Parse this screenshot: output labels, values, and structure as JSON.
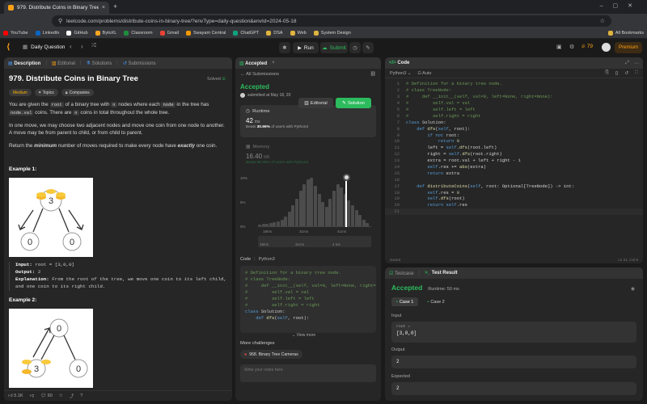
{
  "browser": {
    "tab_title": "979. Distribute Coins in Binary Tree",
    "url": "leetcode.com/problems/distribute-coins-in-binary-tree/?envType=daily-question&envId=2024-05-18",
    "bookmarks": [
      {
        "label": "YouTube",
        "color": "#ff0000"
      },
      {
        "label": "LinkedIn",
        "color": "#0a66c2"
      },
      {
        "label": "GitHub",
        "color": "#ffffff"
      },
      {
        "label": "BytoXL",
        "color": "#f5a623"
      },
      {
        "label": "Classroom",
        "color": "#1e8e3e"
      },
      {
        "label": "Gmail",
        "color": "#ea4335"
      },
      {
        "label": "Swayam Central",
        "color": "#f29900"
      },
      {
        "label": "ChatGPT",
        "color": "#10a37f"
      },
      {
        "label": "DSA",
        "color": "#e0b341"
      },
      {
        "label": "Web",
        "color": "#e0b341"
      },
      {
        "label": "System Design",
        "color": "#e0b341"
      }
    ],
    "all_bookmarks": "All Bookmarks"
  },
  "header": {
    "daily_question": "Daily Question",
    "run": "Run",
    "submit": "Submit",
    "fire_count": "79",
    "premium": "Premium"
  },
  "left": {
    "tabs": [
      "Description",
      "Editorial",
      "Solutions",
      "Submissions"
    ],
    "title": "979. Distribute Coins in Binary Tree",
    "solved": "Solved",
    "difficulty": "Medium",
    "topics": "Topics",
    "companies": "Companies",
    "p1a": "You are given the ",
    "p1_root": "root",
    "p1b": " of a binary tree with ",
    "p1_n": "n",
    "p1c": " nodes where each ",
    "p1_node": "node",
    "p1d": " in the tree has ",
    "p1_nodeval": "node.val",
    "p1e": " coins. There are ",
    "p1f": " coins in total throughout the whole tree.",
    "p2": "In one move, we may choose two adjacent nodes and move one coin from one node to another. A move may be from parent to child, or from child to parent.",
    "p3a": "Return the ",
    "p3b": "minimum",
    "p3c": " number of moves required to make every node have ",
    "p3d": "exactly",
    "p3e": " one coin.",
    "ex1": "Example 1:",
    "ex1_tree": [
      "3",
      "0",
      "0"
    ],
    "ex1_input_label": "Input:",
    "ex1_input": "root = [3,0,0]",
    "ex1_output_label": "Output:",
    "ex1_output": "2",
    "ex1_expl_label": "Explanation:",
    "ex1_expl": "From the root of the tree, we move one coin to its left child, and one coin to its right child.",
    "ex2": "Example 2:",
    "ex2_tree": [
      "0",
      "3",
      "0"
    ],
    "likes": "5.1K",
    "comments": "60"
  },
  "middle": {
    "tab": "Accepted",
    "all_submissions": "All Submissions",
    "status": "Accepted",
    "submitted": "submitted at May 18, 20",
    "editorial": "Editorial",
    "solution": "Solution",
    "runtime_label": "Runtime",
    "runtime_value": "42",
    "runtime_unit": "ms",
    "beats_prefix": "Beats",
    "runtime_beats": "30.96%",
    "beats_suffix": "of users with Python3",
    "memory_label": "Memory",
    "memory_value": "16.40",
    "memory_unit": "MB",
    "memory_beats": "Beats 96.89% of users with Python3",
    "chart_y": [
      "10%",
      "5%",
      "0%"
    ],
    "chart_x": [
      "18ms",
      "31ms",
      "41ms"
    ],
    "mini_x": [
      "18ms",
      "31ms",
      "4 ms"
    ],
    "code_label": "Code",
    "code_lang": "Python3",
    "code_lines": [
      "# Definition for a binary tree node.",
      "# class TreeNode:",
      "#     def __init__(self, val=0, left=None, right=",
      "#         self.val = val",
      "#         self.left = left",
      "#         self.right = right",
      "class Solution:",
      "    def dfs(self, root):"
    ],
    "view_more": "View more",
    "more_challenges": "More challenges",
    "challenge": "968. Binary Tree Cameras",
    "notes_placeholder": "Write your notes here"
  },
  "editor": {
    "tab": "Code",
    "lang": "Python3",
    "auto": "Auto",
    "lines": [
      "# Definition for a binary tree node.",
      "# class TreeNode:",
      "#     def __init__(self, val=0, left=None, right=None):",
      "#         self.val = val",
      "#         self.left = left",
      "#         self.right = right",
      "class Solution:",
      "    def dfs(self, root):",
      "        if not root:",
      "            return 0",
      "        left = self.dfs(root.left)",
      "        right = self.dfs(root.right)",
      "        extra = root.val + left + right - 1",
      "        self.res += abs(extra)",
      "        return extra",
      "",
      "    def distributeCoins(self, root: Optional[TreeNode]) -> int:",
      "        self.res = 0",
      "        self.dfs(root)",
      "        return self.res",
      ""
    ],
    "saved": "Saved",
    "cursor": "Ln 21, Col 9"
  },
  "result": {
    "testcase_tab": "Testcase",
    "result_tab": "Test Result",
    "status": "Accepted",
    "runtime": "Runtime: 50 ms",
    "case1": "Case 1",
    "case2": "Case 2",
    "input_label": "Input",
    "root_label": "root =",
    "root_value": "[3,0,0]",
    "output_label": "Output",
    "output_value": "2",
    "expected_label": "Expected",
    "expected_value": "2"
  },
  "colors": {
    "accent": "#ffa116",
    "accepted": "#2cbb5d",
    "medium": "#ffb800"
  }
}
